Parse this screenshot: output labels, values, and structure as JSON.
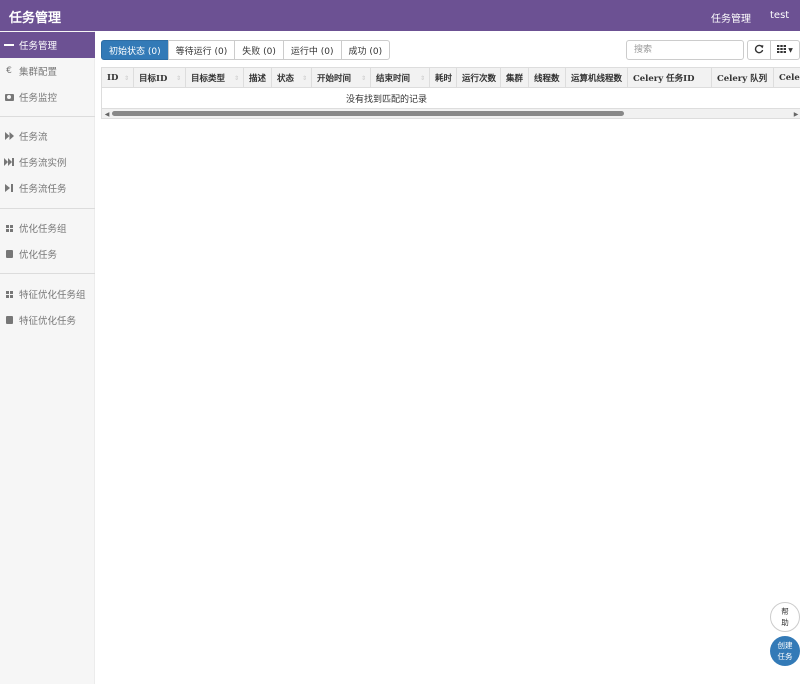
{
  "header": {
    "title": "任务管理",
    "nav": [
      "任务管理",
      "test"
    ]
  },
  "sidebar": {
    "items": [
      {
        "label": "任务管理",
        "icon": "server-icon",
        "active": true
      },
      {
        "label": "集群配置",
        "icon": "euro-icon"
      },
      {
        "label": "任务监控",
        "icon": "camera-icon"
      },
      {
        "label": "任务流",
        "icon": "fast-forward-icon"
      },
      {
        "label": "任务流实例",
        "icon": "step-forward-icon"
      },
      {
        "label": "任务流任务",
        "icon": "skip-forward-icon"
      },
      {
        "label": "优化任务组",
        "icon": "grid-icon"
      },
      {
        "label": "优化任务",
        "icon": "book-icon"
      },
      {
        "label": "特征优化任务组",
        "icon": "grid-icon"
      },
      {
        "label": "特征优化任务",
        "icon": "book-icon"
      }
    ]
  },
  "tabs": [
    "初始状态 (0)",
    "等待运行 (0)",
    "失败 (0)",
    "运行中 (0)",
    "成功 (0)"
  ],
  "toolbar": {
    "search_placeholder": "搜索",
    "refresh_icon": "refresh-icon",
    "columns_icon": "grid-icon"
  },
  "table": {
    "columns": [
      "ID",
      "目标ID",
      "目标类型",
      "描述",
      "状态",
      "开始时间",
      "结束时间",
      "耗时",
      "运行次数",
      "集群",
      "线程数",
      "运算机线程数",
      "Celery 任务ID",
      "Celery 队列",
      "Celery"
    ],
    "empty_text": "没有找到匹配的记录"
  },
  "fab": {
    "help": "帮助",
    "create": "创建任务"
  },
  "colors": {
    "header_bg": "#6c5193",
    "primary": "#337ab7"
  }
}
